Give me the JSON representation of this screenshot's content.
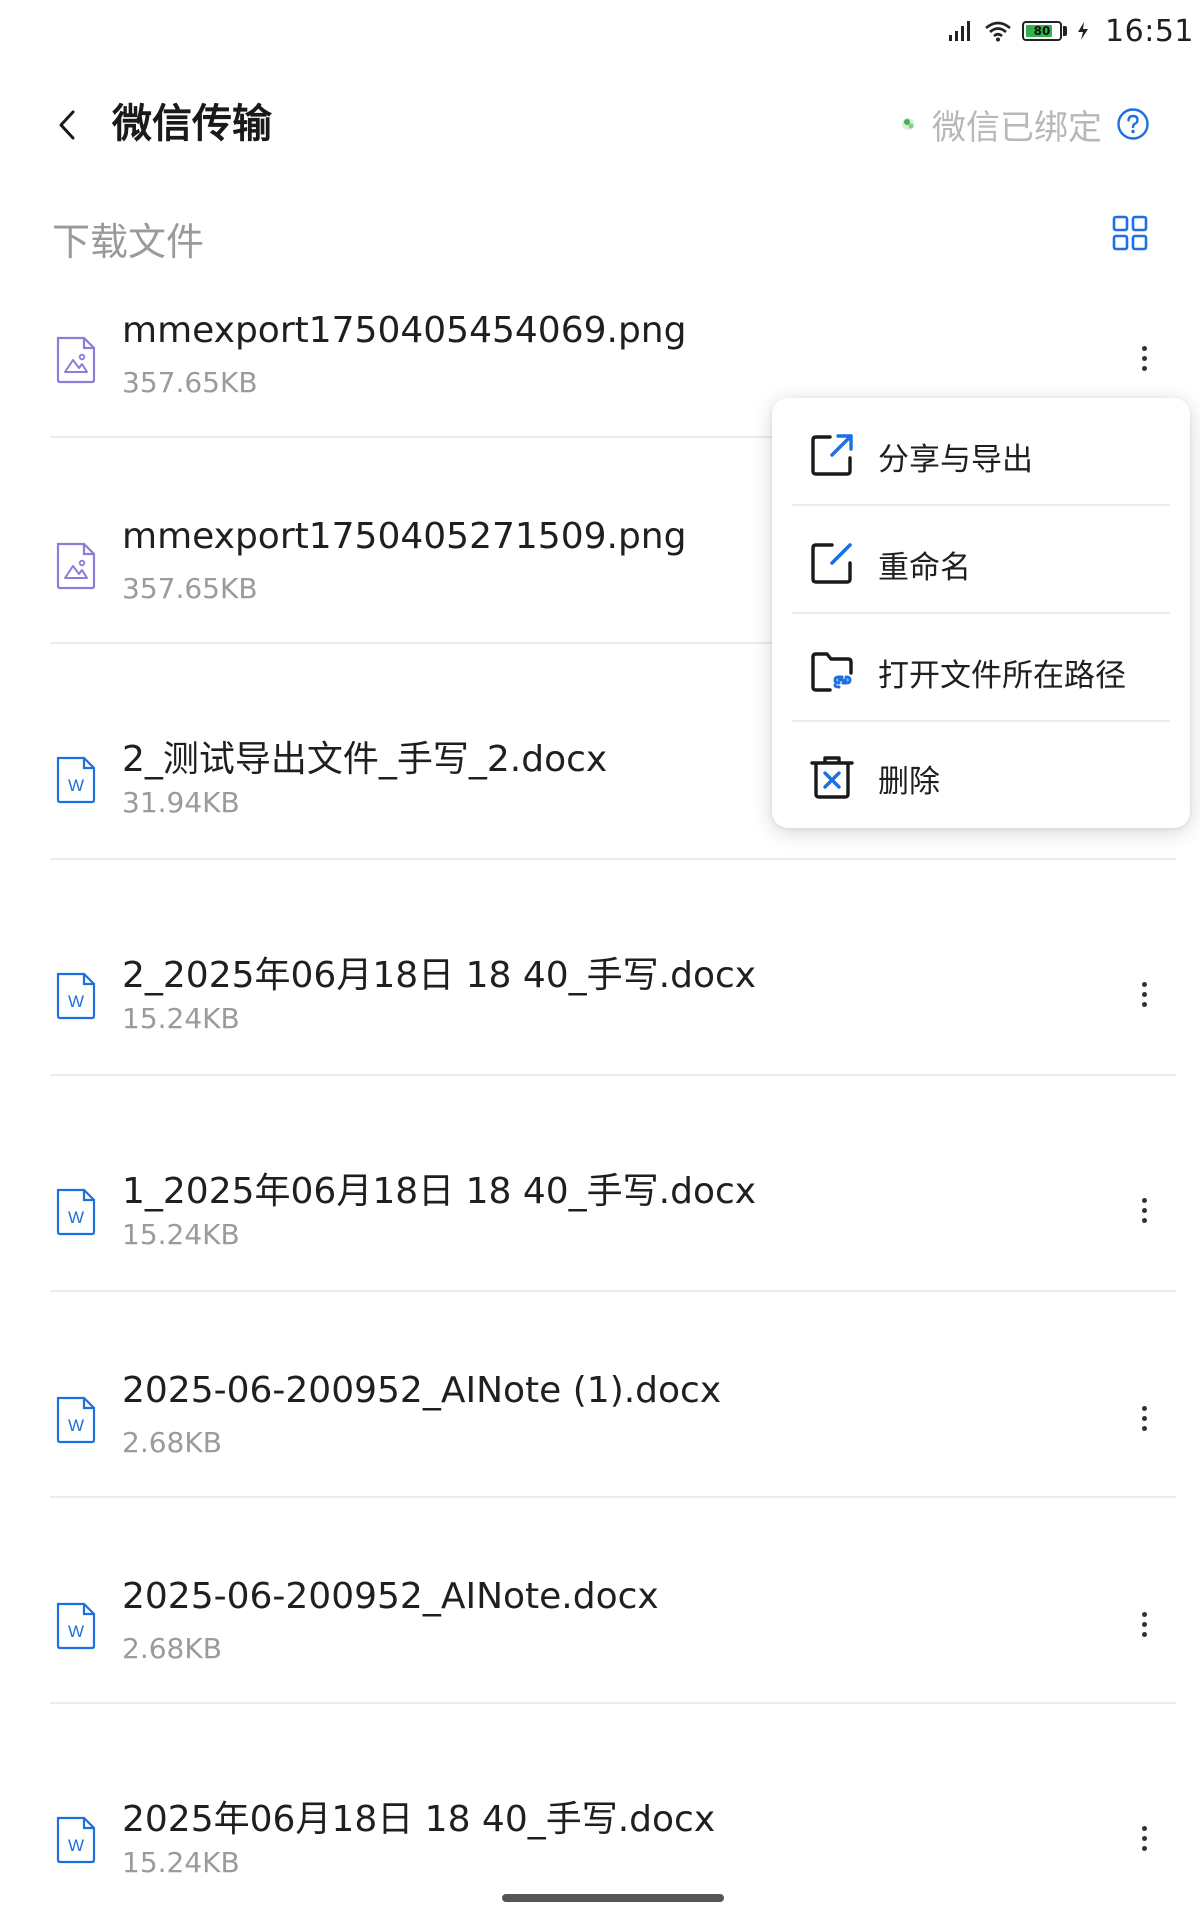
{
  "status_bar": {
    "time": "16:51",
    "battery": "80",
    "battery_level": 0.8
  },
  "header": {
    "title": "微信传输",
    "bind_status": "微信已绑定"
  },
  "section": {
    "title": "下载文件"
  },
  "files": [
    {
      "name": "mmexport1750405454069.png",
      "size": "357.65KB",
      "type": "image"
    },
    {
      "name": "mmexport1750405271509.png",
      "size": "357.65KB",
      "type": "image"
    },
    {
      "name": "2_测试导出文件_手写_2.docx",
      "size": "31.94KB",
      "type": "word"
    },
    {
      "name": "2_2025年06月18日 18 40_手写.docx",
      "size": "15.24KB",
      "type": "word"
    },
    {
      "name": "1_2025年06月18日 18 40_手写.docx",
      "size": "15.24KB",
      "type": "word"
    },
    {
      "name": "2025-06-200952_AINote (1).docx",
      "size": "2.68KB",
      "type": "word"
    },
    {
      "name": "2025-06-200952_AINote.docx",
      "size": "2.68KB",
      "type": "word"
    },
    {
      "name": "2025年06月18日 18 40_手写.docx",
      "size": "15.24KB",
      "type": "word"
    }
  ],
  "context_menu": {
    "items": [
      {
        "label": "分享与导出",
        "icon": "share-export-icon"
      },
      {
        "label": "重命名",
        "icon": "rename-icon"
      },
      {
        "label": "打开文件所在路径",
        "icon": "folder-link-icon"
      },
      {
        "label": "删除",
        "icon": "delete-icon"
      }
    ]
  },
  "colors": {
    "accent": "#1e6fe0",
    "text_primary": "#1f1f1f",
    "text_secondary": "#9b9b9b",
    "wechat_green": "#3cb34a"
  }
}
